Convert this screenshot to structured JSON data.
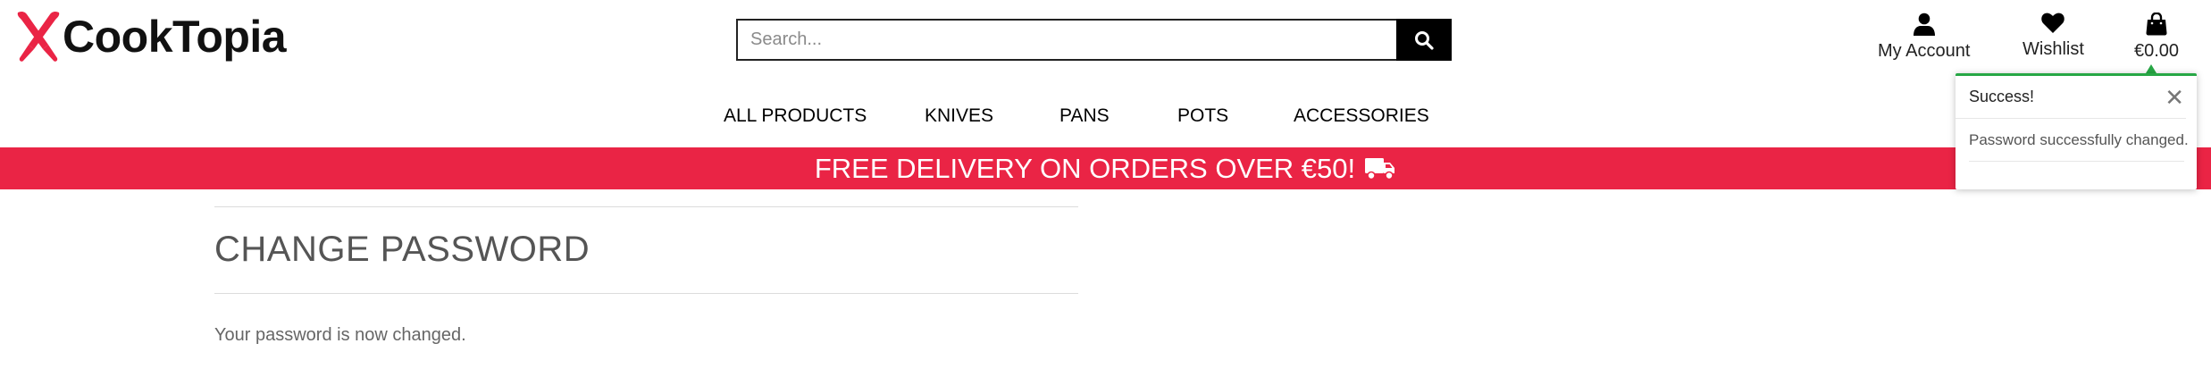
{
  "brand": {
    "name": "CookTopia",
    "accent": "#ea2445"
  },
  "search": {
    "placeholder": "Search...",
    "value": ""
  },
  "header_links": {
    "account": {
      "label": "My Account",
      "icon": "user-icon"
    },
    "wishlist": {
      "label": "Wishlist",
      "icon": "heart-icon"
    },
    "bag": {
      "label": "€0.00",
      "icon": "shopping-bag-icon"
    }
  },
  "nav": {
    "items": [
      {
        "label": "ALL PRODUCTS"
      },
      {
        "label": "KNIVES"
      },
      {
        "label": "PANS"
      },
      {
        "label": "POTS"
      },
      {
        "label": "ACCESSORIES"
      }
    ]
  },
  "banner": {
    "text": "FREE DELIVERY ON ORDERS OVER €50!",
    "icon": "truck-icon"
  },
  "page": {
    "title": "CHANGE PASSWORD",
    "message": "Your password is now changed."
  },
  "toast": {
    "title": "Success!",
    "body": "Password successfully changed.",
    "status_color": "#27a745",
    "close_icon": "close-icon"
  }
}
